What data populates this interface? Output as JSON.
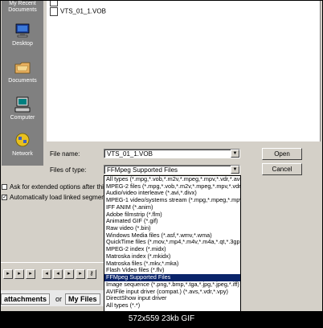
{
  "places": [
    {
      "label_l1": "My Recent",
      "label_l2": "Documents",
      "icon": "recent-documents-icon"
    },
    {
      "label_l1": "Desktop",
      "label_l2": "",
      "icon": "desktop-icon"
    },
    {
      "label_l1": "Documents",
      "label_l2": "",
      "icon": "documents-folder-icon"
    },
    {
      "label_l1": "Computer",
      "label_l2": "",
      "icon": "computer-icon"
    },
    {
      "label_l1": "Network",
      "label_l2": "",
      "icon": "network-icon"
    }
  ],
  "file_list": {
    "files": [
      "VTS_01_1.VOB"
    ]
  },
  "file_name": {
    "label": "File name:",
    "value": "VTS_01_1.VOB"
  },
  "file_type": {
    "label": "Files of type:",
    "value": "FFMpeg Supported Files"
  },
  "buttons": {
    "open": "Open",
    "cancel": "Cancel"
  },
  "checkboxes": {
    "extended_options": "Ask for extended options after this",
    "load_linked": "Automatically load linked segments"
  },
  "type_options": [
    "All types (*.mpg,*.vob,*.m2v,*.mpeg,*.mpv,*.vdr,*.avi,",
    "MPEG-2 files (*.mpg,*.vob,*.m2v,*.mpeg,*.mpv,*.vdr",
    "Audio/video interleave (*.avi,*.divx)",
    "MPEG-1 video/systems stream (*.mpg,*.mpeg,*.mpv,",
    "IFF ANIM (*.anim)",
    "Adobe filmstrip (*.flm)",
    "Animated GIF (*.gif)",
    "Raw video (*.bin)",
    "Windows Media files (*.asf,*.wmv,*.wma)",
    "QuickTime files (*.mov,*.mp4,*.m4v,*.m4a,*.qt,*.3gp",
    "MPEG-2 index (*.midx)",
    "Matroska index (*.mkidx)",
    "Matroska files (*.mkv,*.mka)",
    "Flash Video files (*.flv)",
    "FFMpeg Supported Files",
    "Image sequence (*.png,*.bmp,*.tga,*.jpg,*.jpeg,*.iff)",
    "AVIFile input driver (compat.) (*.avs,*.vdr,*.vpy)",
    "DirectShow input driver",
    "All types (*.*)"
  ],
  "selected_option_index": 14,
  "bottom_links": {
    "attachments": "attachments",
    "or": "or",
    "my_files": "My Files"
  },
  "caption": "572x559 23kb GIF"
}
